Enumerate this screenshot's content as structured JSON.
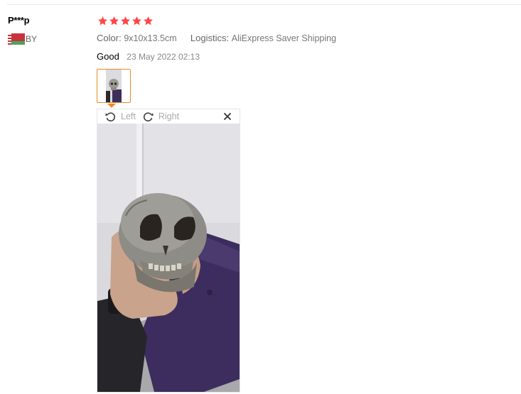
{
  "reviewer": {
    "name": "P***p",
    "country_code": "BY",
    "flag": "belarus-flag"
  },
  "review": {
    "rating": 5,
    "star_color": "#ff4747",
    "attributes": {
      "color_label": "Color:",
      "color_value": "9x10x13.5cm",
      "logistics_label": "Logistics:",
      "logistics_value": "AliExpress Saver Shipping"
    },
    "text": "Good",
    "date": "23 May 2022 02:13"
  },
  "photo_viewer": {
    "rotate_left_label": "Left",
    "rotate_right_label": "Right",
    "accent_color": "#f08a24"
  }
}
